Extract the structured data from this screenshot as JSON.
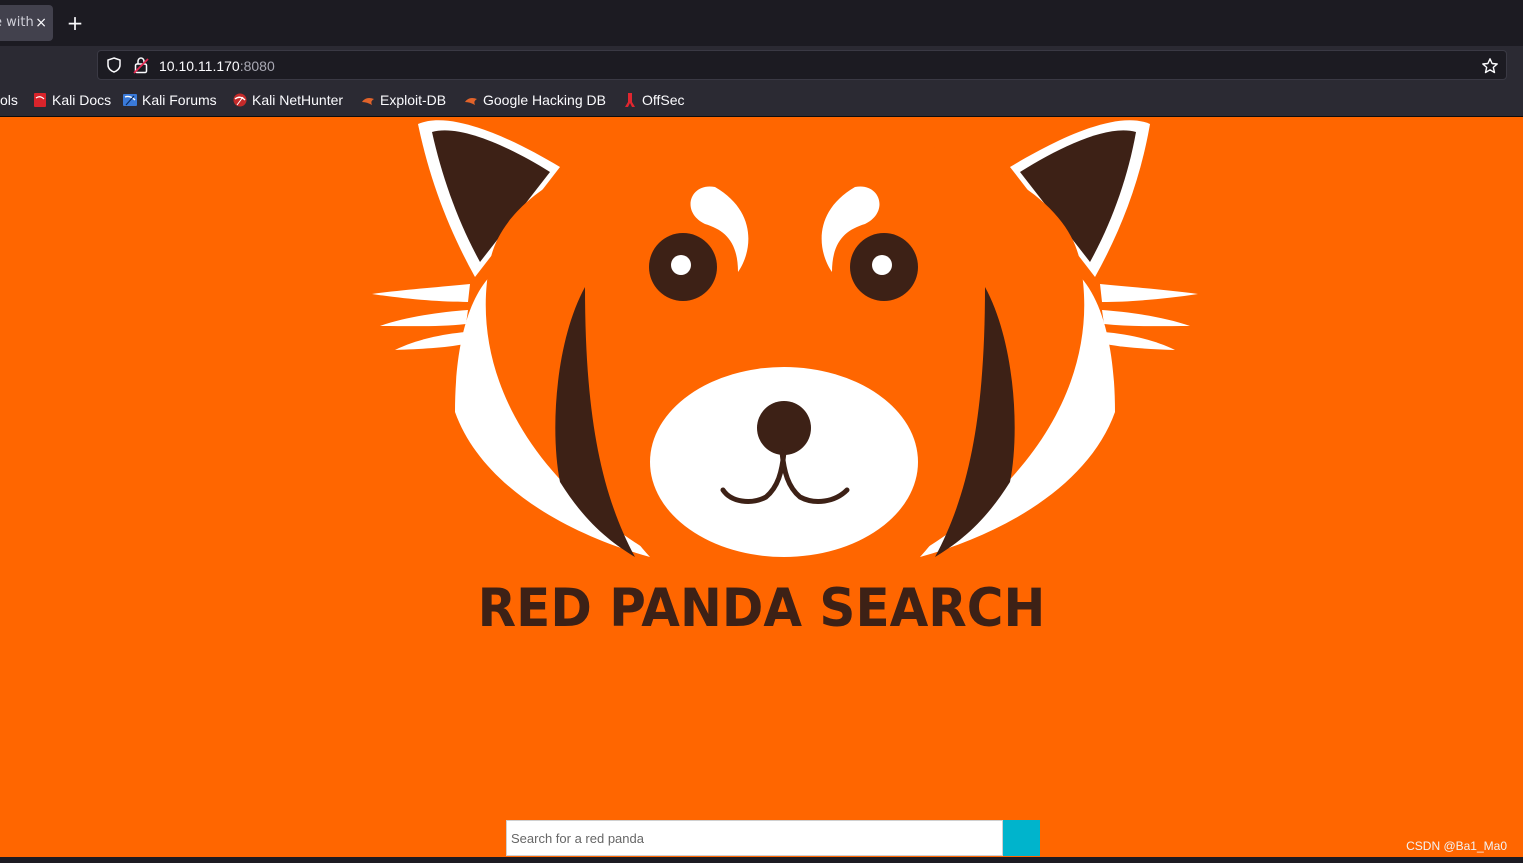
{
  "browser": {
    "tab_title": "e with",
    "tab_close": "×",
    "new_tab": "+",
    "url_host": "10.10.11.170",
    "url_port": ":8080",
    "bookmarks": [
      {
        "label": "ols"
      },
      {
        "label": "Kali Docs"
      },
      {
        "label": "Kali Forums"
      },
      {
        "label": "Kali NetHunter"
      },
      {
        "label": "Exploit-DB"
      },
      {
        "label": "Google Hacking DB"
      },
      {
        "label": "OffSec"
      }
    ]
  },
  "page": {
    "background_color": "#ff6600",
    "logo_title": "RED PANDA SEARCH",
    "search": {
      "placeholder": "Search for a red panda",
      "value": ""
    },
    "button_color": "#00b4cc"
  },
  "watermark": "CSDN @Ba1_Ma0",
  "icons": {
    "shield": "shield-icon",
    "lock": "lock-icon",
    "star": "star-icon",
    "panda": "red-panda-logo"
  }
}
